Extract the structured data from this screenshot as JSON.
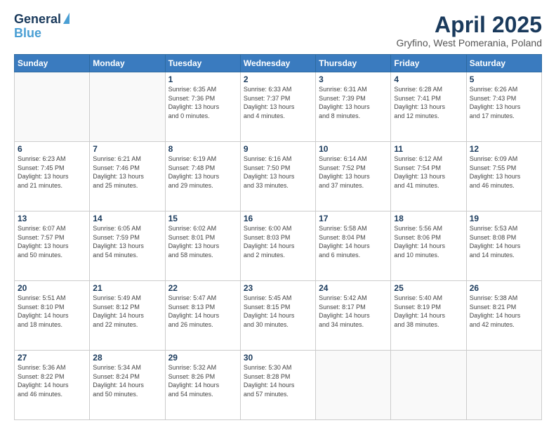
{
  "logo": {
    "line1": "General",
    "line2": "Blue"
  },
  "title": "April 2025",
  "subtitle": "Gryfino, West Pomerania, Poland",
  "days_header": [
    "Sunday",
    "Monday",
    "Tuesday",
    "Wednesday",
    "Thursday",
    "Friday",
    "Saturday"
  ],
  "weeks": [
    [
      {
        "num": "",
        "info": ""
      },
      {
        "num": "",
        "info": ""
      },
      {
        "num": "1",
        "info": "Sunrise: 6:35 AM\nSunset: 7:36 PM\nDaylight: 13 hours\nand 0 minutes."
      },
      {
        "num": "2",
        "info": "Sunrise: 6:33 AM\nSunset: 7:37 PM\nDaylight: 13 hours\nand 4 minutes."
      },
      {
        "num": "3",
        "info": "Sunrise: 6:31 AM\nSunset: 7:39 PM\nDaylight: 13 hours\nand 8 minutes."
      },
      {
        "num": "4",
        "info": "Sunrise: 6:28 AM\nSunset: 7:41 PM\nDaylight: 13 hours\nand 12 minutes."
      },
      {
        "num": "5",
        "info": "Sunrise: 6:26 AM\nSunset: 7:43 PM\nDaylight: 13 hours\nand 17 minutes."
      }
    ],
    [
      {
        "num": "6",
        "info": "Sunrise: 6:23 AM\nSunset: 7:45 PM\nDaylight: 13 hours\nand 21 minutes."
      },
      {
        "num": "7",
        "info": "Sunrise: 6:21 AM\nSunset: 7:46 PM\nDaylight: 13 hours\nand 25 minutes."
      },
      {
        "num": "8",
        "info": "Sunrise: 6:19 AM\nSunset: 7:48 PM\nDaylight: 13 hours\nand 29 minutes."
      },
      {
        "num": "9",
        "info": "Sunrise: 6:16 AM\nSunset: 7:50 PM\nDaylight: 13 hours\nand 33 minutes."
      },
      {
        "num": "10",
        "info": "Sunrise: 6:14 AM\nSunset: 7:52 PM\nDaylight: 13 hours\nand 37 minutes."
      },
      {
        "num": "11",
        "info": "Sunrise: 6:12 AM\nSunset: 7:54 PM\nDaylight: 13 hours\nand 41 minutes."
      },
      {
        "num": "12",
        "info": "Sunrise: 6:09 AM\nSunset: 7:55 PM\nDaylight: 13 hours\nand 46 minutes."
      }
    ],
    [
      {
        "num": "13",
        "info": "Sunrise: 6:07 AM\nSunset: 7:57 PM\nDaylight: 13 hours\nand 50 minutes."
      },
      {
        "num": "14",
        "info": "Sunrise: 6:05 AM\nSunset: 7:59 PM\nDaylight: 13 hours\nand 54 minutes."
      },
      {
        "num": "15",
        "info": "Sunrise: 6:02 AM\nSunset: 8:01 PM\nDaylight: 13 hours\nand 58 minutes."
      },
      {
        "num": "16",
        "info": "Sunrise: 6:00 AM\nSunset: 8:03 PM\nDaylight: 14 hours\nand 2 minutes."
      },
      {
        "num": "17",
        "info": "Sunrise: 5:58 AM\nSunset: 8:04 PM\nDaylight: 14 hours\nand 6 minutes."
      },
      {
        "num": "18",
        "info": "Sunrise: 5:56 AM\nSunset: 8:06 PM\nDaylight: 14 hours\nand 10 minutes."
      },
      {
        "num": "19",
        "info": "Sunrise: 5:53 AM\nSunset: 8:08 PM\nDaylight: 14 hours\nand 14 minutes."
      }
    ],
    [
      {
        "num": "20",
        "info": "Sunrise: 5:51 AM\nSunset: 8:10 PM\nDaylight: 14 hours\nand 18 minutes."
      },
      {
        "num": "21",
        "info": "Sunrise: 5:49 AM\nSunset: 8:12 PM\nDaylight: 14 hours\nand 22 minutes."
      },
      {
        "num": "22",
        "info": "Sunrise: 5:47 AM\nSunset: 8:13 PM\nDaylight: 14 hours\nand 26 minutes."
      },
      {
        "num": "23",
        "info": "Sunrise: 5:45 AM\nSunset: 8:15 PM\nDaylight: 14 hours\nand 30 minutes."
      },
      {
        "num": "24",
        "info": "Sunrise: 5:42 AM\nSunset: 8:17 PM\nDaylight: 14 hours\nand 34 minutes."
      },
      {
        "num": "25",
        "info": "Sunrise: 5:40 AM\nSunset: 8:19 PM\nDaylight: 14 hours\nand 38 minutes."
      },
      {
        "num": "26",
        "info": "Sunrise: 5:38 AM\nSunset: 8:21 PM\nDaylight: 14 hours\nand 42 minutes."
      }
    ],
    [
      {
        "num": "27",
        "info": "Sunrise: 5:36 AM\nSunset: 8:22 PM\nDaylight: 14 hours\nand 46 minutes."
      },
      {
        "num": "28",
        "info": "Sunrise: 5:34 AM\nSunset: 8:24 PM\nDaylight: 14 hours\nand 50 minutes."
      },
      {
        "num": "29",
        "info": "Sunrise: 5:32 AM\nSunset: 8:26 PM\nDaylight: 14 hours\nand 54 minutes."
      },
      {
        "num": "30",
        "info": "Sunrise: 5:30 AM\nSunset: 8:28 PM\nDaylight: 14 hours\nand 57 minutes."
      },
      {
        "num": "",
        "info": ""
      },
      {
        "num": "",
        "info": ""
      },
      {
        "num": "",
        "info": ""
      }
    ]
  ]
}
